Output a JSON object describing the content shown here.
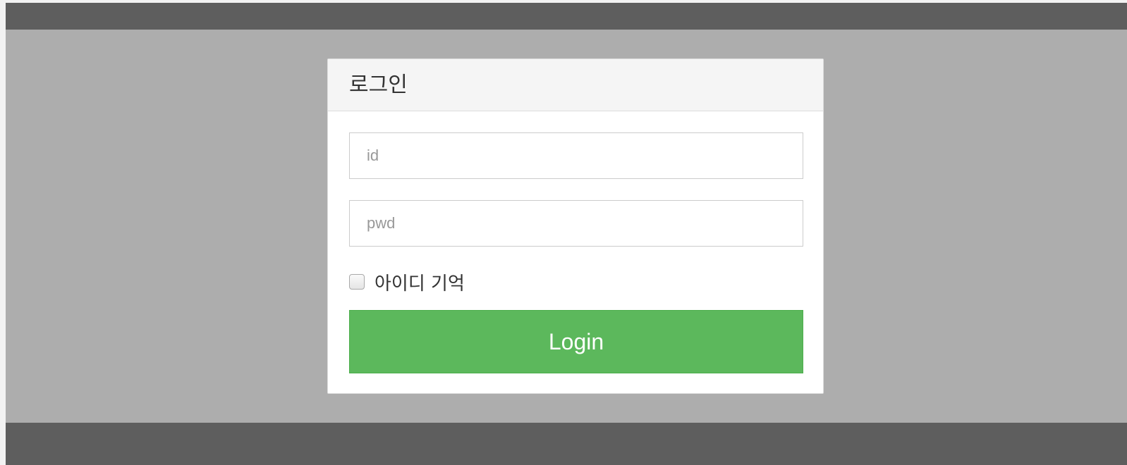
{
  "login_panel": {
    "title": "로그인",
    "id_field": {
      "placeholder": "id",
      "value": ""
    },
    "pwd_field": {
      "placeholder": "pwd",
      "value": ""
    },
    "remember": {
      "label": "아이디 기억",
      "checked": false
    },
    "login_button": {
      "label": "Login"
    }
  },
  "colors": {
    "top_bar": "#5e5e5e",
    "background": "#adadad",
    "panel_heading": "#f5f5f5",
    "login_button": "#5cb85c"
  }
}
